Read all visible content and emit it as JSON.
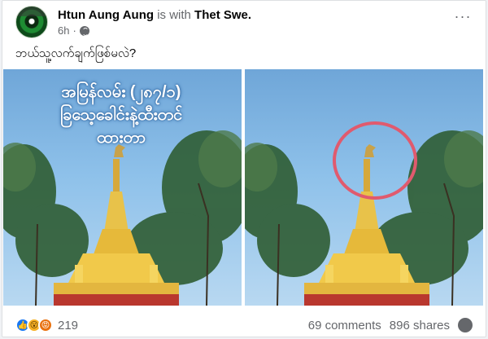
{
  "post": {
    "author": "Htun Aung Aung",
    "with_text": "is with",
    "tagged": "Thet Swe.",
    "time": "6h",
    "privacy_icon": "globe-icon",
    "more_icon": "more-dots-icon",
    "caption": "ဘယ်သူ့လက်ချက်ဖြစ်မလဲ?"
  },
  "photos": {
    "left_overlay_text": "အမြန်လမ်း (၂၈၇/၁)\nခြသေ့ခေါင်းနဲ့ထီးတင်\nထားတာ"
  },
  "footer": {
    "reaction_icons": [
      "like-icon",
      "wow-icon",
      "angry-icon"
    ],
    "reaction_count": "219",
    "comments": "69 comments",
    "shares": "896 shares"
  },
  "colors": {
    "link_blue": "#1877f2",
    "muted_text": "#65676b",
    "highlight_circle": "#e05a6e",
    "pagoda_gold": "#e8c24a"
  }
}
